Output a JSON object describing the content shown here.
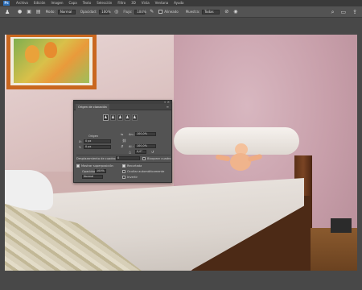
{
  "menu": {
    "logo": "Ps",
    "items": [
      "Archivo",
      "Edición",
      "Imagen",
      "Capa",
      "Texto",
      "Selección",
      "Filtro",
      "3D",
      "Vista",
      "Ventana",
      "Ayuda"
    ]
  },
  "options": {
    "tool_icon": "clone-stamp-icon",
    "modo_label": "Modo:",
    "modo_value": "Normal",
    "opacidad_label": "Opacidad:",
    "opacidad_value": "100%",
    "flujo_label": "Flujo:",
    "flujo_value": "100%",
    "alineado_label": "Alineado",
    "muestra_label": "Muestra:",
    "muestra_value": "Todas"
  },
  "dialog": {
    "title": "Origen de clonación",
    "origen_label": "Origen",
    "x_label": "X:",
    "x_value": "0 px",
    "y_label": "Y:",
    "y_value": "0 px",
    "an_label": "An.:",
    "an_value": "100,0%",
    "al_label": "Al.:",
    "al_value": "100,0%",
    "angle_value": "0,0",
    "angle_unit": "°",
    "desplazamiento_label": "Desplazamiento de cuadro:",
    "desplazamiento_value": "0",
    "bloquear_label": "Bloquear cuadro",
    "mostrar_label": "Mostrar superposición",
    "recortada_label": "Recortada",
    "opacidad_label": "Opacidad:",
    "opacidad_value": "100%",
    "ocultar_label": "Ocultar automáticamente",
    "normal_value": "Normal",
    "invertir_label": "Invertir"
  },
  "colors": {
    "ui_dark": "#3a3a3a",
    "panel": "#535353",
    "accent_frame": "#c9671f"
  }
}
